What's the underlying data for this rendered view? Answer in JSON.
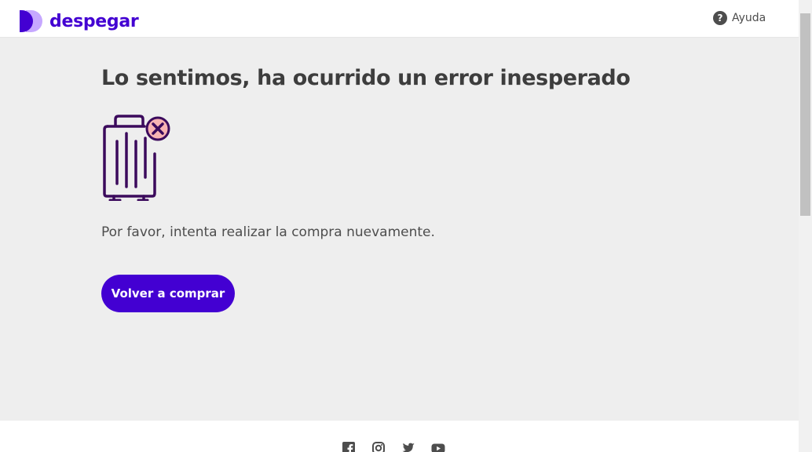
{
  "header": {
    "brand": "despegar",
    "help_label": "Ayuda",
    "help_icon": "question-circle-icon"
  },
  "main": {
    "title": "Lo sentimos, ha ocurrido un error inesperado",
    "illustration_icon": "luggage-error-icon",
    "message": "Por favor, intenta realizar la compra nuevamente.",
    "cta_label": "Volver a comprar"
  },
  "footer": {
    "social_icons": [
      "facebook-icon",
      "instagram-icon",
      "twitter-icon",
      "youtube-icon"
    ]
  },
  "colors": {
    "brand": "#4300d2",
    "brand_light": "#c6a8ff",
    "background": "#eeeeee",
    "text_dark": "#3d3d3d",
    "illustration_stroke": "#3b0a5c",
    "illustration_badge": "#f7b3b3"
  }
}
